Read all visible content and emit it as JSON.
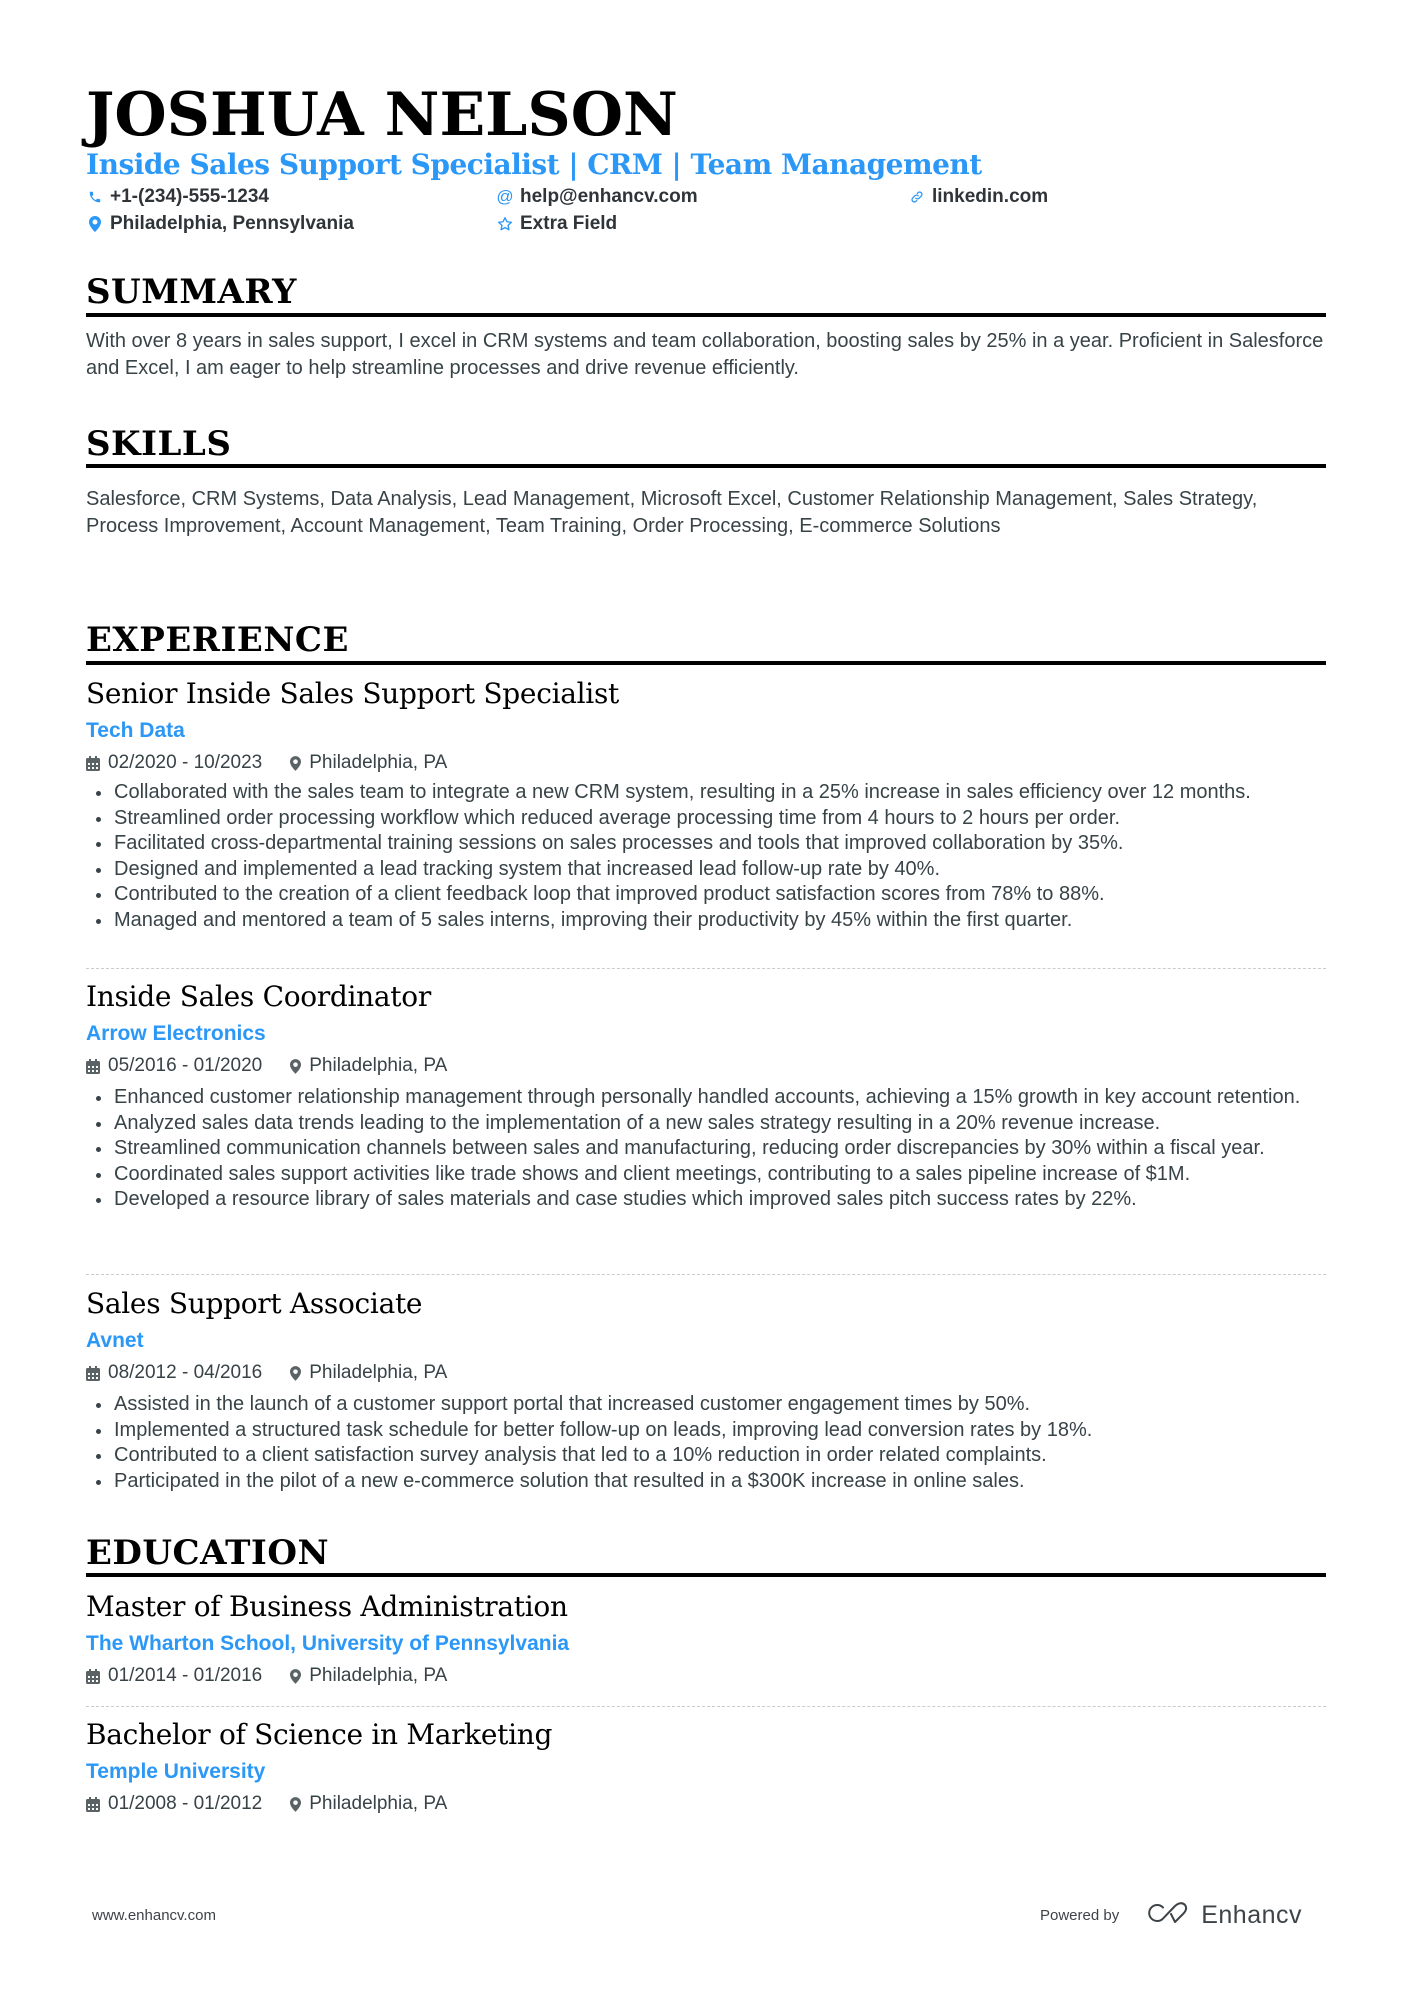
{
  "header": {
    "name": "JOSHUA NELSON",
    "headline": "Inside Sales Support Specialist | CRM | Team Management",
    "contacts": [
      {
        "icon": "phone-icon",
        "text": "+1-(234)-555-1234"
      },
      {
        "icon": "at-icon",
        "text": "help@enhancv.com"
      },
      {
        "icon": "link-icon",
        "text": "linkedin.com"
      },
      {
        "icon": "location-pin-icon",
        "text": "Philadelphia, Pennsylvania"
      },
      {
        "icon": "star-icon",
        "text": "Extra Field"
      }
    ]
  },
  "summary": {
    "title": "SUMMARY",
    "text": "With over 8 years in sales support, I excel in CRM systems and team collaboration, boosting sales by 25% in a year. Proficient in Salesforce and Excel, I am eager to help streamline processes and drive revenue efficiently."
  },
  "skills": {
    "title": "SKILLS",
    "text": "Salesforce, CRM Systems, Data Analysis, Lead Management, Microsoft Excel, Customer Relationship Management, Sales Strategy, Process Improvement, Account Management, Team Training, Order Processing, E-commerce Solutions"
  },
  "experience": {
    "title": "EXPERIENCE",
    "jobs": [
      {
        "title": "Senior Inside Sales Support Specialist",
        "company": "Tech Data",
        "dates": "02/2020 - 10/2023",
        "location": "Philadelphia, PA",
        "bullets": [
          "Collaborated with the sales team to integrate a new CRM system, resulting in a 25% increase in sales efficiency over 12 months.",
          "Streamlined order processing workflow which reduced average processing time from 4 hours to 2 hours per order.",
          "Facilitated cross-departmental training sessions on sales processes and tools that improved collaboration by 35%.",
          "Designed and implemented a lead tracking system that increased lead follow-up rate by 40%.",
          "Contributed to the creation of a client feedback loop that improved product satisfaction scores from 78% to 88%.",
          "Managed and mentored a team of 5 sales interns, improving their productivity by 45% within the first quarter."
        ]
      },
      {
        "title": "Inside Sales Coordinator",
        "company": "Arrow Electronics",
        "dates": "05/2016 - 01/2020",
        "location": "Philadelphia, PA",
        "bullets": [
          "Enhanced customer relationship management through personally handled accounts, achieving a 15% growth in key account retention.",
          "Analyzed sales data trends leading to the implementation of a new sales strategy resulting in a 20% revenue increase.",
          "Streamlined communication channels between sales and manufacturing, reducing order discrepancies by 30% within a fiscal year.",
          "Coordinated sales support activities like trade shows and client meetings, contributing to a sales pipeline increase of $1M.",
          "Developed a resource library of sales materials and case studies which improved sales pitch success rates by 22%."
        ]
      },
      {
        "title": "Sales Support Associate",
        "company": "Avnet",
        "dates": "08/2012 - 04/2016",
        "location": "Philadelphia, PA",
        "bullets": [
          "Assisted in the launch of a customer support portal that increased customer engagement times by 50%.",
          "Implemented a structured task schedule for better follow-up on leads, improving lead conversion rates by 18%.",
          "Contributed to a client satisfaction survey analysis that led to a 10% reduction in order related complaints.",
          "Participated in the pilot of a new e-commerce solution that resulted in a $300K increase in online sales."
        ]
      }
    ]
  },
  "education": {
    "title": "EDUCATION",
    "items": [
      {
        "degree": "Master of Business Administration",
        "school": "The Wharton School, University of Pennsylvania",
        "dates": "01/2014 - 01/2016",
        "location": "Philadelphia, PA"
      },
      {
        "degree": "Bachelor of Science in Marketing",
        "school": "Temple University",
        "dates": "01/2008 - 01/2012",
        "location": "Philadelphia, PA"
      }
    ]
  },
  "footer": {
    "website": "www.enhancv.com",
    "powered_by": "Powered by",
    "brand": "Enhancv"
  },
  "colors": {
    "accent": "#2b97f6",
    "heading": "#000000",
    "body": "#384347"
  }
}
